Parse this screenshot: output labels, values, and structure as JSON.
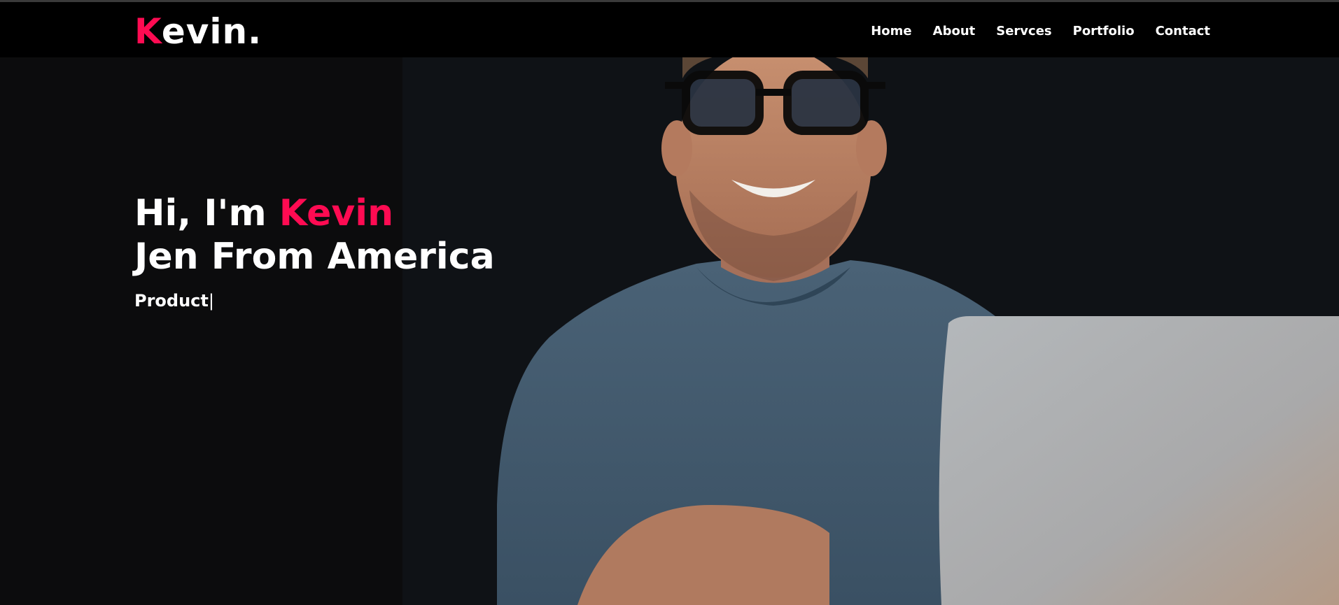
{
  "header": {
    "logo_initial": "K",
    "logo_rest": "evin.",
    "nav": [
      "Home",
      "About",
      "Servces",
      "Portfolio",
      "Contact"
    ]
  },
  "hero": {
    "greeting": "Hi, I'm ",
    "name": "Kevin",
    "subtitle": "Jen From America",
    "typed_text": "Product",
    "cursor": "|"
  },
  "colors": {
    "accent": "#ff0b52",
    "navbar_bg": "#000000",
    "hero_bg": "#0c0c0d"
  }
}
